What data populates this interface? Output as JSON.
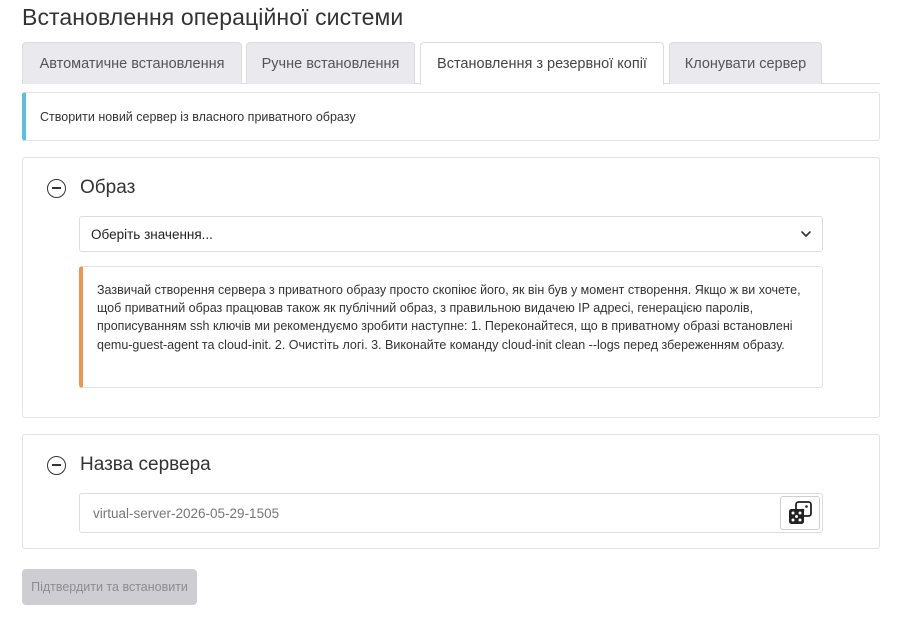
{
  "page": {
    "title": "Встановлення операційної системи"
  },
  "tabs": [
    {
      "label": "Автоматичне встановлення",
      "active": false
    },
    {
      "label": "Ручне встановлення",
      "active": false
    },
    {
      "label": "Встановлення з резервної копії",
      "active": true
    },
    {
      "label": "Клонувати сервер",
      "active": false
    }
  ],
  "info": {
    "text": "Створити новий сервер із власного приватного образу"
  },
  "image_section": {
    "title": "Образ",
    "select": {
      "value": "Оберіть значення..."
    },
    "warning": "Зазвичай створення сервера з приватного образу просто скопіює його, як він був у момент створення. Якщо ж ви хочете, щоб приватний образ працював також як публічний образ, з правильною видачею IP адресі, генерацією паролів, прописуванням ssh ключів ми рекомендуємо зробити наступне: 1. Переконайтеся, що в приватному образі встановлені qemu-guest-agent та cloud-init. 2. Очистіть логі. 3. Виконайте команду cloud-init clean --logs перед збереженням образу."
  },
  "name_section": {
    "title": "Назва сервера",
    "input": {
      "value": "virtual-server-2026-05-29-1505"
    }
  },
  "actions": {
    "submit_label": "Підтвердити та встановити"
  },
  "colors": {
    "info_accent": "#5bc0de",
    "warning_accent": "#f0954f",
    "disabled_button": "#cdcdd2"
  },
  "icons": {
    "collapse": "minus-circle-icon",
    "select": "chevron-down-icon",
    "random": "dice-icon"
  }
}
